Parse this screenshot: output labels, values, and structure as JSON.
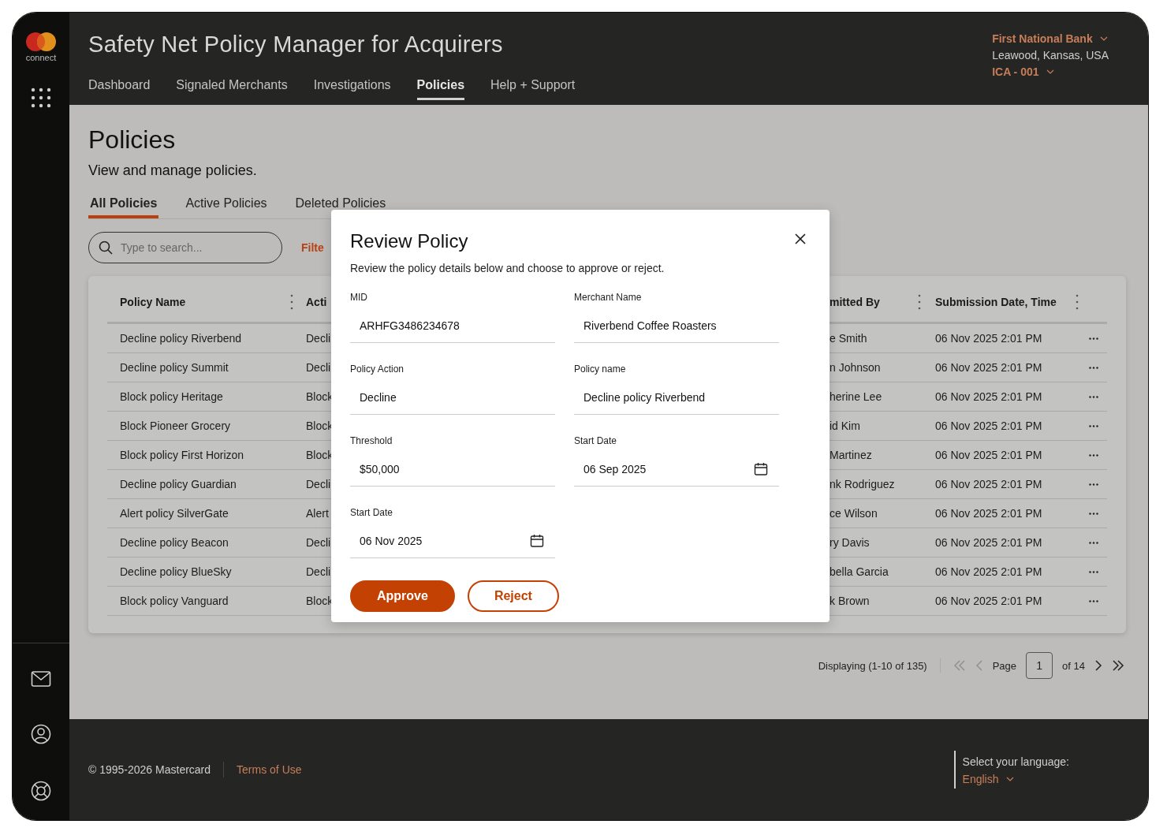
{
  "app": {
    "logo_text": "connect",
    "title": "Safety Net Policy Manager for Acquirers"
  },
  "nav": [
    {
      "label": "Dashboard",
      "selected": false
    },
    {
      "label": "Signaled Merchants",
      "selected": false
    },
    {
      "label": "Investigations",
      "selected": false
    },
    {
      "label": "Policies",
      "selected": true
    },
    {
      "label": "Help + Support",
      "selected": false
    }
  ],
  "account": {
    "bank": "First National Bank",
    "location": "Leawood, Kansas, USA",
    "ica": "ICA - 001"
  },
  "page": {
    "title": "Policies",
    "subtitle": "View and manage policies."
  },
  "tabs": [
    {
      "label": "All Policies",
      "selected": true
    },
    {
      "label": "Active Policies",
      "selected": false
    },
    {
      "label": "Deleted Policies",
      "selected": false
    }
  ],
  "search": {
    "placeholder": "Type to search..."
  },
  "filter_link": "Filte",
  "table": {
    "columns": [
      "Policy Name",
      "Acti",
      "mitted By",
      "Submission Date, Time"
    ],
    "rows": [
      {
        "policy_name": "Decline policy Riverbend",
        "column_2": "Decli",
        "column_3": "e Smith",
        "submission_date": "06 Nov 2025 2:01 PM"
      },
      {
        "policy_name": "Decline policy Summit",
        "column_2": "Decli",
        "column_3": "n Johnson",
        "submission_date": "06 Nov 2025 2:01 PM"
      },
      {
        "policy_name": "Block policy Heritage",
        "column_2": "Block",
        "column_3": "herine Lee",
        "submission_date": "06 Nov 2025 2:01 PM"
      },
      {
        "policy_name": "Block Pioneer Grocery",
        "column_2": "Block",
        "column_3": "id Kim",
        "submission_date": "06 Nov 2025 2:01 PM"
      },
      {
        "policy_name": "Block policy First Horizon",
        "column_2": "Block",
        "column_3": "Martinez",
        "submission_date": "06 Nov 2025 2:01 PM"
      },
      {
        "policy_name": "Decline policy Guardian",
        "column_2": "Decli",
        "column_3": "nk Rodriguez",
        "submission_date": "06 Nov 2025 2:01 PM"
      },
      {
        "policy_name": "Alert policy SilverGate",
        "column_2": "Alert",
        "column_3": "ce Wilson",
        "submission_date": "06 Nov 2025 2:01 PM"
      },
      {
        "policy_name": "Decline policy Beacon",
        "column_2": "Decli",
        "column_3": "ry Davis",
        "submission_date": "06 Nov 2025 2:01 PM"
      },
      {
        "policy_name": "Decline policy BlueSky",
        "column_2": "Decli",
        "column_3": "bella Garcia",
        "submission_date": "06 Nov 2025 2:01 PM"
      },
      {
        "policy_name": "Block policy Vanguard",
        "column_2": "Block",
        "column_3": "k Brown",
        "submission_date": "06 Nov 2025 2:01 PM"
      }
    ]
  },
  "pagination": {
    "summary": "Displaying (1-10 of 135)",
    "page_label": "Page",
    "page": "1",
    "total": "of 14"
  },
  "modal": {
    "title": "Review Policy",
    "description": "Review the policy details below and choose to approve or reject.",
    "fields": [
      {
        "label": "MID",
        "value": "ARHFG3486234678",
        "kind": "text"
      },
      {
        "label": "Merchant Name",
        "value": "Riverbend Coffee Roasters",
        "kind": "text"
      },
      {
        "label": "Policy Action",
        "value": "Decline",
        "kind": "text"
      },
      {
        "label": "Policy name",
        "value": "Decline policy Riverbend",
        "kind": "text"
      },
      {
        "label": "Threshold",
        "value": "$50,000",
        "kind": "text"
      },
      {
        "label": "Start Date",
        "value": "06 Sep 2025",
        "kind": "date"
      },
      {
        "label": "Start Date",
        "value": "06 Nov 2025",
        "kind": "date"
      }
    ],
    "approve": "Approve",
    "reject": "Reject"
  },
  "footer": {
    "copyright": "© 1995-2026 Mastercard",
    "terms": "Terms of Use",
    "language_label": "Select your language:",
    "language": "English"
  }
}
